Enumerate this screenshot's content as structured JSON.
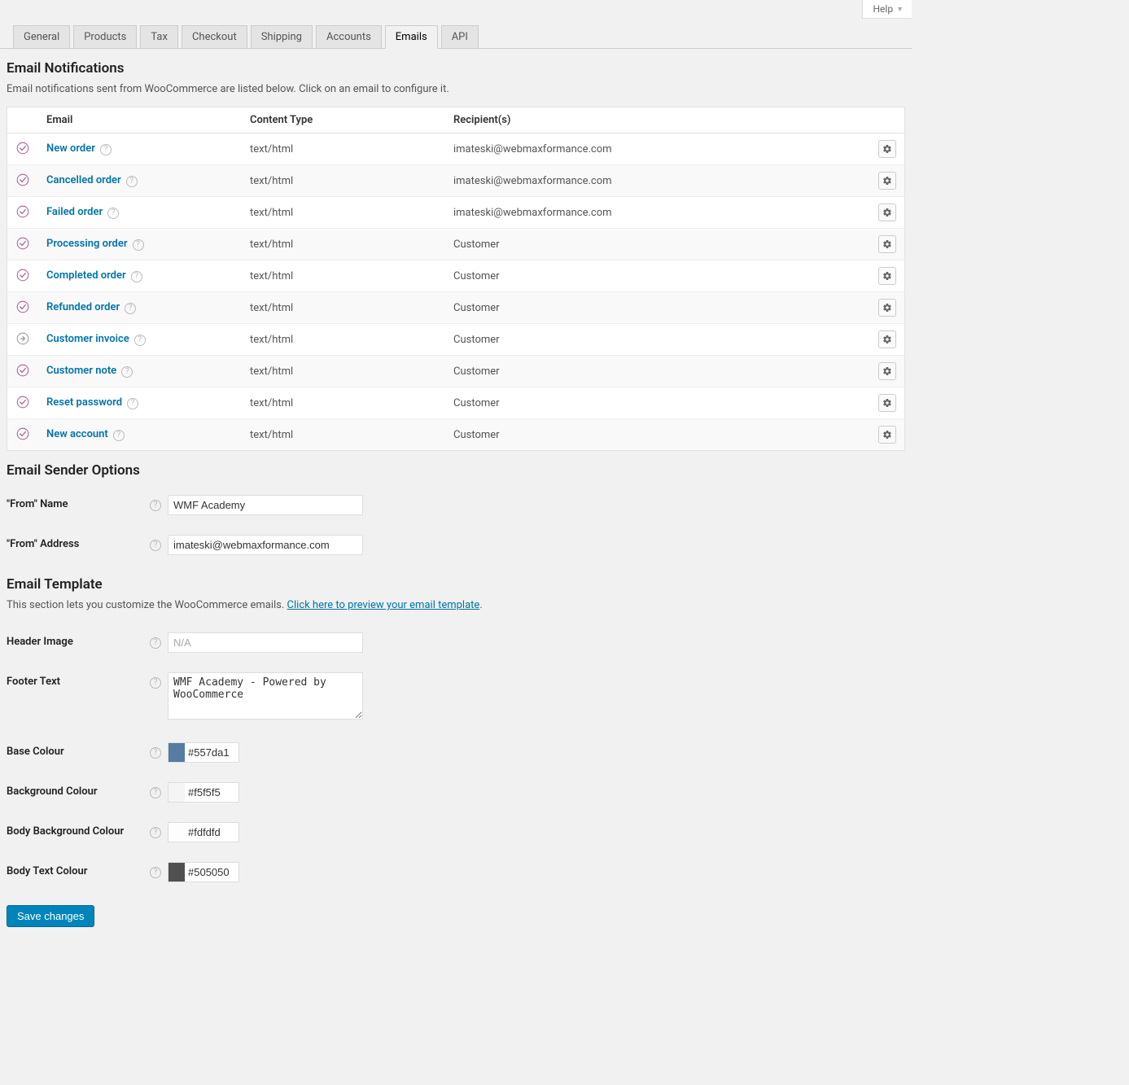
{
  "topbar": {
    "help": "Help"
  },
  "tabs": [
    {
      "label": "General"
    },
    {
      "label": "Products"
    },
    {
      "label": "Tax"
    },
    {
      "label": "Checkout"
    },
    {
      "label": "Shipping"
    },
    {
      "label": "Accounts"
    },
    {
      "label": "Emails",
      "active": true
    },
    {
      "label": "API"
    }
  ],
  "notifications": {
    "heading": "Email Notifications",
    "desc": "Email notifications sent from WooCommerce are listed below. Click on an email to configure it.",
    "columns": {
      "blank": "",
      "email": "Email",
      "content_type": "Content Type",
      "recipients": "Recipient(s)",
      "actions": ""
    },
    "rows": [
      {
        "status": "enabled",
        "name": "New order",
        "content_type": "text/html",
        "recipient": "imateski@webmaxformance.com"
      },
      {
        "status": "enabled",
        "name": "Cancelled order",
        "content_type": "text/html",
        "recipient": "imateski@webmaxformance.com"
      },
      {
        "status": "enabled",
        "name": "Failed order",
        "content_type": "text/html",
        "recipient": "imateski@webmaxformance.com"
      },
      {
        "status": "enabled",
        "name": "Processing order",
        "content_type": "text/html",
        "recipient": "Customer"
      },
      {
        "status": "enabled",
        "name": "Completed order",
        "content_type": "text/html",
        "recipient": "Customer"
      },
      {
        "status": "enabled",
        "name": "Refunded order",
        "content_type": "text/html",
        "recipient": "Customer"
      },
      {
        "status": "manual",
        "name": "Customer invoice",
        "content_type": "text/html",
        "recipient": "Customer"
      },
      {
        "status": "enabled",
        "name": "Customer note",
        "content_type": "text/html",
        "recipient": "Customer"
      },
      {
        "status": "enabled",
        "name": "Reset password",
        "content_type": "text/html",
        "recipient": "Customer"
      },
      {
        "status": "enabled",
        "name": "New account",
        "content_type": "text/html",
        "recipient": "Customer"
      }
    ]
  },
  "sender": {
    "heading": "Email Sender Options",
    "from_name_label": "\"From\" Name",
    "from_name_value": "WMF Academy",
    "from_addr_label": "\"From\" Address",
    "from_addr_value": "imateski@webmaxformance.com"
  },
  "template": {
    "heading": "Email Template",
    "desc_pre": "This section lets you customize the WooCommerce emails. ",
    "desc_link": "Click here to preview your email template",
    "desc_post": ".",
    "header_image_label": "Header Image",
    "header_image_placeholder": "N/A",
    "footer_text_label": "Footer Text",
    "footer_text_value": "WMF Academy - Powered by WooCommerce",
    "base_colour_label": "Base Colour",
    "base_colour_value": "#557da1",
    "bg_colour_label": "Background Colour",
    "bg_colour_value": "#f5f5f5",
    "body_bg_colour_label": "Body Background Colour",
    "body_bg_colour_value": "#fdfdfd",
    "body_text_colour_label": "Body Text Colour",
    "body_text_colour_value": "#505050"
  },
  "save": "Save changes"
}
